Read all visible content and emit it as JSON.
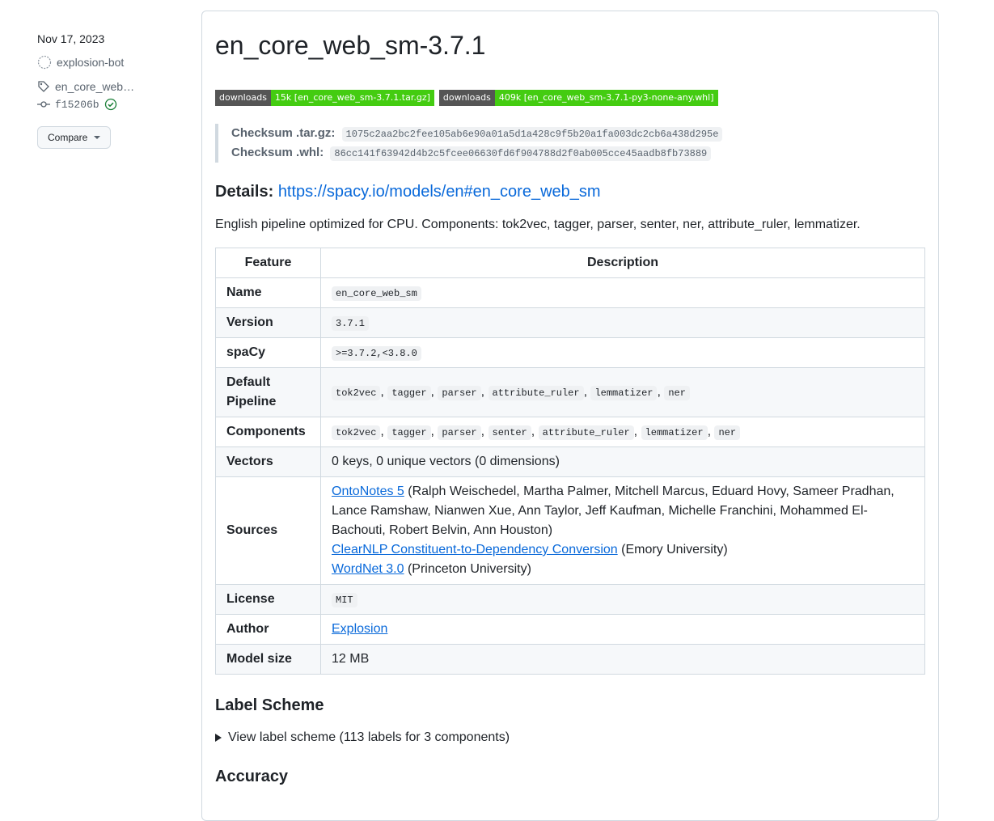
{
  "sidebar": {
    "date": "Nov 17, 2023",
    "author": "explosion-bot",
    "tag": "en_core_web_...",
    "commit": "f15206b",
    "compare_label": "Compare"
  },
  "release": {
    "title": "en_core_web_sm-3.7.1",
    "badges": [
      {
        "label": "downloads",
        "value": "15k [en_core_web_sm-3.7.1.tar.gz]"
      },
      {
        "label": "downloads",
        "value": "409k [en_core_web_sm-3.7.1-py3-none-any.whl]"
      }
    ],
    "checksums": [
      {
        "label": "Checksum .tar.gz:",
        "value": "1075c2aa2bc2fee105ab6e90a01a5d1a428c9f5b20a1fa003dc2cb6a438d295e"
      },
      {
        "label": "Checksum .whl:",
        "value": "86cc141f63942d4b2c5fcee06630fd6f904788d2f0ab005cce45aadb8fb73889"
      }
    ],
    "details_label": "Details:",
    "details_link": "https://spacy.io/models/en#en_core_web_sm",
    "description": "English pipeline optimized for CPU. Components: tok2vec, tagger, parser, senter, ner, attribute_ruler, lemmatizer.",
    "table": {
      "headers": [
        "Feature",
        "Description"
      ],
      "name_label": "Name",
      "name_value": "en_core_web_sm",
      "version_label": "Version",
      "version_value": "3.7.1",
      "spacy_label": "spaCy",
      "spacy_value": ">=3.7.2,<3.8.0",
      "pipeline_label": "Default Pipeline",
      "pipeline": [
        "tok2vec",
        "tagger",
        "parser",
        "attribute_ruler",
        "lemmatizer",
        "ner"
      ],
      "components_label": "Components",
      "components": [
        "tok2vec",
        "tagger",
        "parser",
        "senter",
        "attribute_ruler",
        "lemmatizer",
        "ner"
      ],
      "vectors_label": "Vectors",
      "vectors_value": "0 keys, 0 unique vectors (0 dimensions)",
      "sources_label": "Sources",
      "sources": {
        "link1": "OntoNotes 5",
        "text1": " (Ralph Weischedel, Martha Palmer, Mitchell Marcus, Eduard Hovy, Sameer Pradhan, Lance Ramshaw, Nianwen Xue, Ann Taylor, Jeff Kaufman, Michelle Franchini, Mohammed El-Bachouti, Robert Belvin, Ann Houston)",
        "link2": "ClearNLP Constituent-to-Dependency Conversion",
        "text2": " (Emory University)",
        "link3": "WordNet 3.0",
        "text3": " (Princeton University)"
      },
      "license_label": "License",
      "license_value": "MIT",
      "author_label": "Author",
      "author_value": "Explosion",
      "size_label": "Model size",
      "size_value": "12 MB"
    },
    "label_scheme_heading": "Label Scheme",
    "label_scheme_summary": "View label scheme (113 labels for 3 components)",
    "accuracy_heading": "Accuracy"
  }
}
